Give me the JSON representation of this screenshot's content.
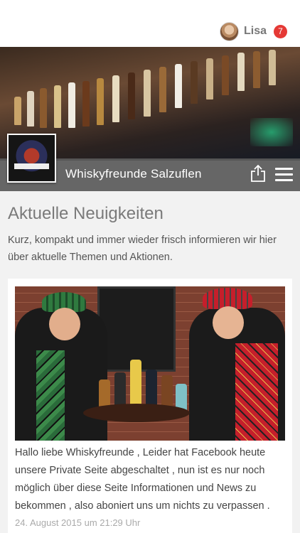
{
  "user": {
    "name": "Lisa",
    "notification_count": "7",
    "avatar_icon": "user-avatar"
  },
  "header": {
    "title": "Whiskyfreunde Salzuflen",
    "share_icon": "share-icon",
    "menu_icon": "hamburger-menu-icon"
  },
  "news": {
    "section_title": "Aktuelle Neuigkeiten",
    "intro": "Kurz, kompakt und immer wieder frisch informieren wir hier über aktuelle Themen und Aktionen.",
    "posts": [
      {
        "text": "Hallo liebe Whiskyfreunde , Leider hat Facebook heute unsere Private Seite abgeschaltet , nun ist es nur noch möglich über diese Seite Informationen und News zu bekommen , also aboniert uns um nichts zu verpassen .",
        "date": "24. August 2015 um 21:29 Uhr"
      }
    ]
  },
  "colors": {
    "badge": "#e53935",
    "titlebar": "#5a5a5a",
    "section_title": "#7a7a7a"
  }
}
